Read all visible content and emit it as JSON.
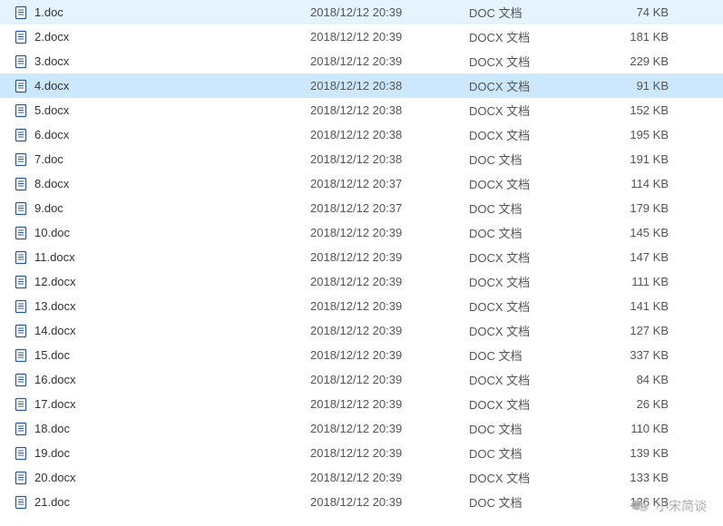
{
  "files": [
    {
      "name": "1.doc",
      "date": "2018/12/12 20:39",
      "type": "DOC 文档",
      "size": "74 KB",
      "ext": "doc",
      "selected": false
    },
    {
      "name": "2.docx",
      "date": "2018/12/12 20:39",
      "type": "DOCX 文档",
      "size": "181 KB",
      "ext": "docx",
      "selected": false
    },
    {
      "name": "3.docx",
      "date": "2018/12/12 20:39",
      "type": "DOCX 文档",
      "size": "229 KB",
      "ext": "docx",
      "selected": false
    },
    {
      "name": "4.docx",
      "date": "2018/12/12 20:38",
      "type": "DOCX 文档",
      "size": "91 KB",
      "ext": "docx",
      "selected": true
    },
    {
      "name": "5.docx",
      "date": "2018/12/12 20:38",
      "type": "DOCX 文档",
      "size": "152 KB",
      "ext": "docx",
      "selected": false
    },
    {
      "name": "6.docx",
      "date": "2018/12/12 20:38",
      "type": "DOCX 文档",
      "size": "195 KB",
      "ext": "docx",
      "selected": false
    },
    {
      "name": "7.doc",
      "date": "2018/12/12 20:38",
      "type": "DOC 文档",
      "size": "191 KB",
      "ext": "doc",
      "selected": false
    },
    {
      "name": "8.docx",
      "date": "2018/12/12 20:37",
      "type": "DOCX 文档",
      "size": "114 KB",
      "ext": "docx",
      "selected": false
    },
    {
      "name": "9.doc",
      "date": "2018/12/12 20:37",
      "type": "DOC 文档",
      "size": "179 KB",
      "ext": "doc",
      "selected": false
    },
    {
      "name": "10.doc",
      "date": "2018/12/12 20:39",
      "type": "DOC 文档",
      "size": "145 KB",
      "ext": "doc",
      "selected": false
    },
    {
      "name": "11.docx",
      "date": "2018/12/12 20:39",
      "type": "DOCX 文档",
      "size": "147 KB",
      "ext": "docx",
      "selected": false
    },
    {
      "name": "12.docx",
      "date": "2018/12/12 20:39",
      "type": "DOCX 文档",
      "size": "111 KB",
      "ext": "docx",
      "selected": false
    },
    {
      "name": "13.docx",
      "date": "2018/12/12 20:39",
      "type": "DOCX 文档",
      "size": "141 KB",
      "ext": "docx",
      "selected": false
    },
    {
      "name": "14.docx",
      "date": "2018/12/12 20:39",
      "type": "DOCX 文档",
      "size": "127 KB",
      "ext": "docx",
      "selected": false
    },
    {
      "name": "15.doc",
      "date": "2018/12/12 20:39",
      "type": "DOC 文档",
      "size": "337 KB",
      "ext": "doc",
      "selected": false
    },
    {
      "name": "16.docx",
      "date": "2018/12/12 20:39",
      "type": "DOCX 文档",
      "size": "84 KB",
      "ext": "docx",
      "selected": false
    },
    {
      "name": "17.docx",
      "date": "2018/12/12 20:39",
      "type": "DOCX 文档",
      "size": "26 KB",
      "ext": "docx",
      "selected": false
    },
    {
      "name": "18.doc",
      "date": "2018/12/12 20:39",
      "type": "DOC 文档",
      "size": "110 KB",
      "ext": "doc",
      "selected": false
    },
    {
      "name": "19.doc",
      "date": "2018/12/12 20:39",
      "type": "DOC 文档",
      "size": "139 KB",
      "ext": "doc",
      "selected": false
    },
    {
      "name": "20.docx",
      "date": "2018/12/12 20:39",
      "type": "DOCX 文档",
      "size": "133 KB",
      "ext": "docx",
      "selected": false
    },
    {
      "name": "21.doc",
      "date": "2018/12/12 20:39",
      "type": "DOC 文档",
      "size": "136 KB",
      "ext": "doc",
      "selected": false
    }
  ],
  "watermark": {
    "text": "小宋简谈"
  },
  "colors": {
    "doc_icon_stroke": "#2b579a",
    "doc_icon_fill": "#ffffff",
    "selected_bg": "#cce8ff"
  }
}
